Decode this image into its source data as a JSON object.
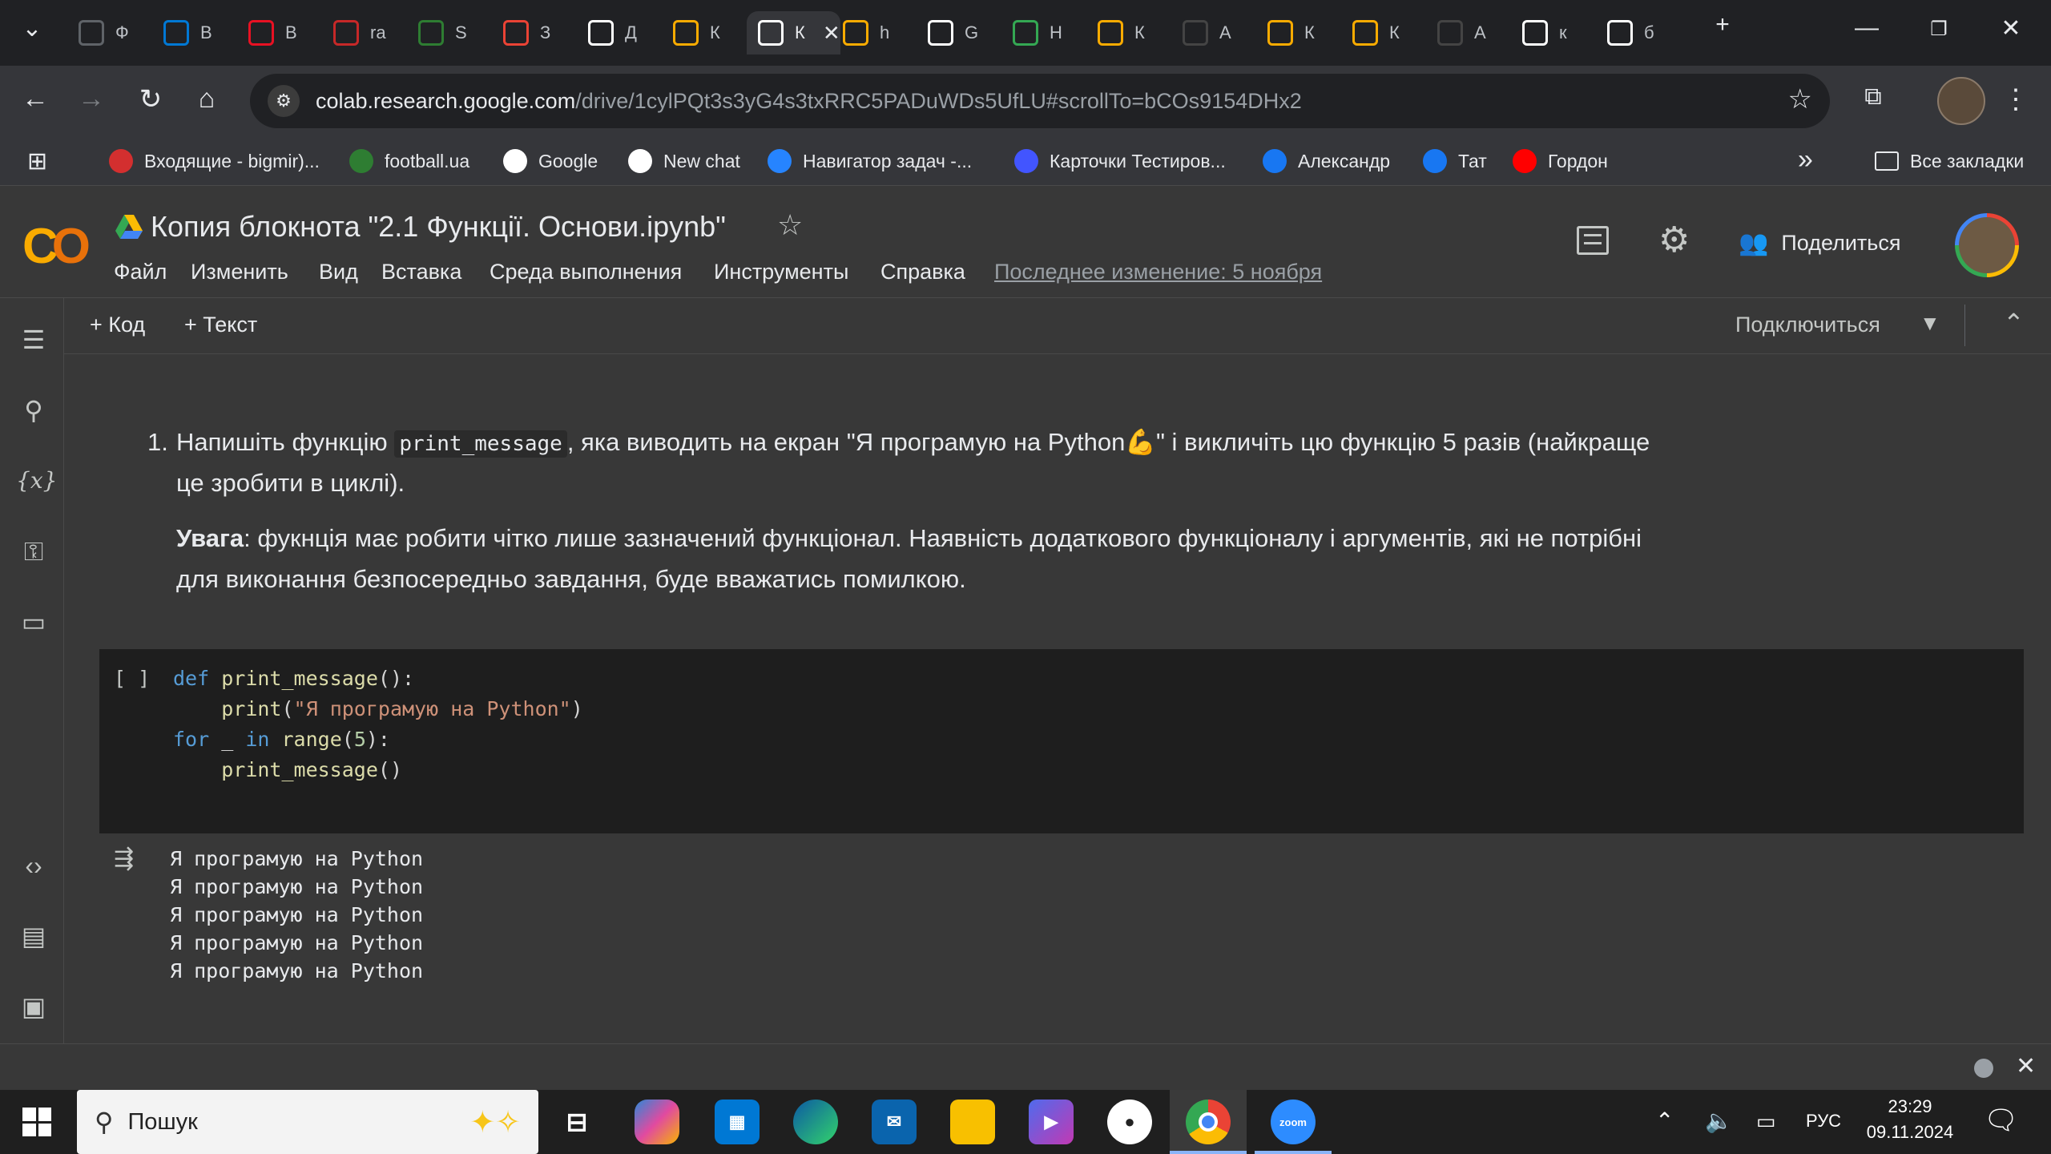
{
  "browser": {
    "tabs": [
      {
        "favicon": "hd-icon",
        "label": "Ф",
        "color": "#5f6368"
      },
      {
        "favicon": "azure-icon",
        "label": "В",
        "color": "#0078d4"
      },
      {
        "favicon": "q-icon",
        "label": "В",
        "color": "#e81123"
      },
      {
        "favicon": "racing-icon",
        "label": "ra",
        "color": "#c62828"
      },
      {
        "favicon": "w-icon",
        "label": "S",
        "color": "#2e7d32"
      },
      {
        "favicon": "q-search-icon",
        "label": "З",
        "color": "#ea4335"
      },
      {
        "favicon": "k-icon",
        "label": "Д",
        "color": "#ffffff"
      },
      {
        "favicon": "colab-icon",
        "label": "К",
        "color": "#f9ab00"
      },
      {
        "favicon": "k-icon",
        "label": "К",
        "color": "#ffffff",
        "active": true
      },
      {
        "favicon": "colab-icon",
        "label": "h",
        "color": "#f9ab00"
      },
      {
        "favicon": "chatgpt-icon",
        "label": "G",
        "color": "#ffffff"
      },
      {
        "favicon": "drive-icon",
        "label": "Н",
        "color": "#34a853"
      },
      {
        "favicon": "colab-icon",
        "label": "К",
        "color": "#f9ab00"
      },
      {
        "favicon": "github-icon",
        "label": "А",
        "color": "#444444"
      },
      {
        "favicon": "colab-icon",
        "label": "К",
        "color": "#f9ab00"
      },
      {
        "favicon": "colab-icon",
        "label": "К",
        "color": "#f9ab00"
      },
      {
        "favicon": "github-icon",
        "label": "А",
        "color": "#444444"
      },
      {
        "favicon": "google-icon",
        "label": "к",
        "color": "#ffffff"
      },
      {
        "favicon": "google-icon",
        "label": "б",
        "color": "#ffffff"
      }
    ],
    "new_tab": "+",
    "url_host": "colab.research.google.com",
    "url_rest": "/drive/1cylPQt3s3yG4s3txRRC5PADuWDs5UfLU#scrollTo=bCOs9154DHx2",
    "bookmarks": [
      {
        "icon": "bigmir-icon",
        "label": "Входящие - bigmir)...",
        "color": "#d32f2f"
      },
      {
        "icon": "football-icon",
        "label": "football.ua",
        "color": "#2e7d32"
      },
      {
        "icon": "google-icon",
        "label": "Google",
        "color": "#ffffff"
      },
      {
        "icon": "chatgpt-icon",
        "label": "New chat",
        "color": "#ffffff"
      },
      {
        "icon": "jira-icon",
        "label": "Навигатор задач -...",
        "color": "#2684ff"
      },
      {
        "icon": "quizlet-icon",
        "label": "Карточки Тестиров...",
        "color": "#4255ff"
      },
      {
        "icon": "facebook-icon",
        "label": "Александр",
        "color": "#1877f2"
      },
      {
        "icon": "facebook-icon",
        "label": "Тат",
        "color": "#1877f2"
      },
      {
        "icon": "youtube-icon",
        "label": "Гордон",
        "color": "#ff0000"
      }
    ],
    "more_bookmarks": "»",
    "all_bookmarks": "Все закладки"
  },
  "colab": {
    "title": "Копия блокнота \"2.1 Функції. Основи.ipynb\"",
    "menu": [
      "Файл",
      "Изменить",
      "Вид",
      "Вставка",
      "Среда выполнения",
      "Инструменты",
      "Справка"
    ],
    "last_edit": "Последнее изменение: 5 ноября",
    "share_label": "Поделиться",
    "add_code": "Код",
    "add_text": "Текст",
    "connect": "Подключиться"
  },
  "notebook": {
    "task_number": "1.",
    "task_part1": "Напишіть функцію",
    "task_code": "print_message",
    "task_part2": ", яка виводить на екран \"Я програмую на Python",
    "task_emoji": "💪",
    "task_part3": "\" і викличіть цю функцію 5 разів (найкраще",
    "task_line2": "це зробити в циклі).",
    "note_bold": "Увага",
    "note_line1": ": фукнція має робити чітко лише зазначений функціонал. Наявність додаткового функціоналу і аргументів, які не потрібні",
    "note_line2": "для виконання безпосередньо завдання, буде вважатись помилкою.",
    "cell_run_marker": "[ ]",
    "code": {
      "l1_kw": "def",
      "l1_fn": "print_message",
      "l1_end": "():",
      "l2_fn": "print",
      "l2_open": "(",
      "l2_str": "\"Я програмую на Python\"",
      "l2_close": ")",
      "l3_kw": "for",
      "l3_var": " _ ",
      "l3_in": "in",
      "l3_fn": "range",
      "l3_open": "(",
      "l3_num": "5",
      "l3_close": "):",
      "l4_fn": "print_message",
      "l4_end": "()"
    },
    "output": [
      "Я програмую на Python",
      "Я програмую на Python",
      "Я програмую на Python",
      "Я програмую на Python",
      "Я програмую на Python"
    ]
  },
  "taskbar": {
    "search_placeholder": "Пошук",
    "lang": "РУС",
    "time": "23:29",
    "date": "09.11.2024"
  }
}
